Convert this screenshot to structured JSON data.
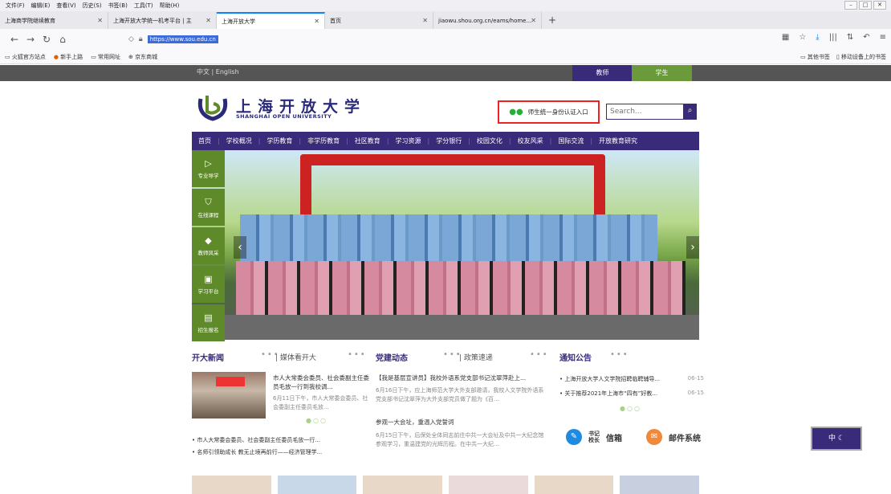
{
  "browser": {
    "menu": [
      "文件(F)",
      "编辑(E)",
      "查看(V)",
      "历史(S)",
      "书签(B)",
      "工具(T)",
      "帮助(H)"
    ],
    "tabs": [
      {
        "title": "上海商学院继续教育"
      },
      {
        "title": "上海开放大学统一机考平台 | 主"
      },
      {
        "title": "上海开放大学"
      },
      {
        "title": "首页"
      },
      {
        "title": "jiaowu.shou.org.cn/eams/home..."
      }
    ],
    "new_tab": "+",
    "url": "https://www.sou.edu.cn",
    "bookmarks": [
      "火狐官方站点",
      "新手上路",
      "常用网址",
      "京东商城"
    ],
    "bookmarks_right": [
      "其他书签",
      "移动设备上的书签"
    ]
  },
  "site": {
    "lang": "中文 | English",
    "teacher": "教师",
    "student": "学生",
    "name_cn": "上海开放大学",
    "name_en": "SHANGHAI OPEN UNIVERSITY",
    "auth_entry": "师生统一身份认证入口",
    "search_placeholder": "Search...",
    "nav": [
      "首页",
      "学校概况",
      "学历教育",
      "非学历教育",
      "社区教育",
      "学习资源",
      "学分银行",
      "校园文化",
      "校友风采",
      "国际交流",
      "开放教育研究"
    ],
    "quick": [
      "专业导学",
      "在线课程",
      "教师风采",
      "学习平台",
      "招生报名"
    ],
    "news": {
      "title": "开大新闻",
      "tab2": "媒体看开大",
      "headline": "市人大常委会委员、社会委副主任委员毛放一行到我校调...",
      "summary": "6月11日下午，市人大常委会委员、社会委副主任委员毛放...",
      "items": [
        "市人大常委会委员、社会委副主任委员毛放一行...",
        "名师引领助成长 教无止境再前行——经济管理学..."
      ]
    },
    "party": {
      "title": "党建动态",
      "tab2": "政策速递",
      "item1_title": "【我是基层宣讲员】我校外语系党支部书记沈翠萍赴上...",
      "item1_body": "6月16日下午，应上海师范大学大外支部邀请，我校人文学院外语系党支部书记沈翠萍为大外支部党员做了题为《百...",
      "item2_title": "参观一大会址，重温入党誓词",
      "item2_body": "6月15日下午，后保处全体同志前往中共一大会址及中共一大纪念馆参观学习，重温建党的光辉历程。在中共一大纪..."
    },
    "notice": {
      "title": "通知公告",
      "items": [
        {
          "text": "上海开放大学人文学院招聘临聘辅导...",
          "date": "06-15"
        },
        {
          "text": "关于推荐2021年上海市“四有”好教...",
          "date": "06-15"
        }
      ]
    },
    "cards": {
      "mailbox_small": "书记\n校长",
      "mailbox": "信箱",
      "mail_system": "邮件系统"
    },
    "floater": "中"
  }
}
